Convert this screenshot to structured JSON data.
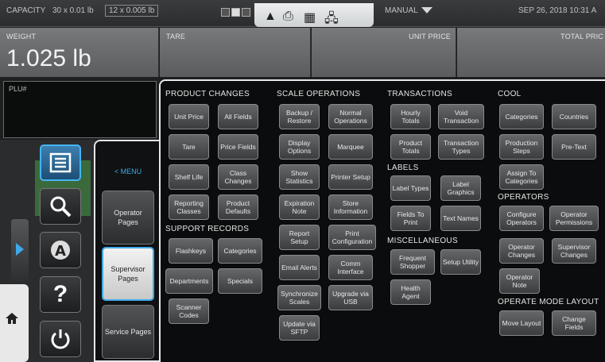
{
  "status_bar": {
    "capacity_label": "CAPACITY",
    "capacity_main": "30 x 0.01 lb",
    "capacity_alt": "12 x 0.005 lb",
    "mode": "MANUAL",
    "datetime": "SEP 26, 2018 10:31 A"
  },
  "readouts": {
    "weight_label": "WEIGHT",
    "weight_value": "1.025 lb",
    "tare_label": "TARE",
    "unit_price_label": "UNIT PRICE",
    "total_price_label": "TOTAL PRIC"
  },
  "plu": {
    "label": "PLU#"
  },
  "menu": {
    "title": "< MENU",
    "pages": [
      "Operator Pages",
      "Supervisor Pages",
      "Service Pages"
    ],
    "active_page": "Supervisor Pages"
  },
  "sections": {
    "product_changes": "PRODUCT CHANGES",
    "support_records": "SUPPORT RECORDS",
    "scale_operations": "SCALE OPERATIONS",
    "transactions": "TRANSACTIONS",
    "labels": "LABELS",
    "miscellaneous": "MISCELLANEOUS",
    "cool": "COOL",
    "operators": "OPERATORS",
    "operate_mode_layout": "OPERATE MODE LAYOUT"
  },
  "buttons": {
    "unit_price": "Unit Price",
    "all_fields": "All Fields",
    "tare": "Tare",
    "price_fields": "Price Fields",
    "shelf_life": "Shelf Life",
    "class_changes": "Class Changes",
    "reporting_classes": "Reporting Classes",
    "product_defaults": "Product Defaults",
    "flashkeys": "Flashkeys",
    "categories_support": "Categories",
    "departments": "Departments",
    "specials": "Specials",
    "scanner_codes": "Scanner Codes",
    "backup_restore": "Backup / Restore",
    "normal_operations": "Normal Operations",
    "display_options": "Display Options",
    "marquee": "Marquee",
    "show_statistics": "Show Statistics",
    "printer_setup": "Printer Setup",
    "expiration_note": "Expiration Note",
    "store_information": "Store Information",
    "report_setup": "Report Setup",
    "print_configuration": "Print Configuration",
    "email_alerts": "Email Alerts",
    "comm_interface": "Comm Interface",
    "synchronize_scales": "Synchronize Scales",
    "upgrade_via_usb": "Upgrade via USB",
    "update_via_sftp": "Update via SFTP",
    "hourly_totals": "Hourly Totals",
    "void_transaction": "Void Transaction",
    "product_totals": "Product Totals",
    "transaction_types": "Transaction Types",
    "label_types": "Label Types",
    "label_graphics": "Label Graphics",
    "fields_to_print": "Fields To Print",
    "text_names": "Text Names",
    "frequent_shopper": "Frequent Shopper",
    "setup_utility": "Setup Utility",
    "health_agent": "Health Agent",
    "categories_cool": "Categories",
    "countries": "Countries",
    "production_steps": "Production Steps",
    "pre_text": "Pre-Text",
    "assign_to_categories": "Assign To Categories",
    "configure_operators": "Configure Operators",
    "operator_permissions": "Operator Permissions",
    "operator_changes": "Operator Changes",
    "supervisor_changes": "Supervisor Changes",
    "operator_note": "Operator Note",
    "move_layout": "Move Layout",
    "change_fields": "Change Fields"
  },
  "colors": {
    "accent": "#3fa9e8",
    "panel": "#0b0c0d",
    "button": "#4a4c4e"
  }
}
